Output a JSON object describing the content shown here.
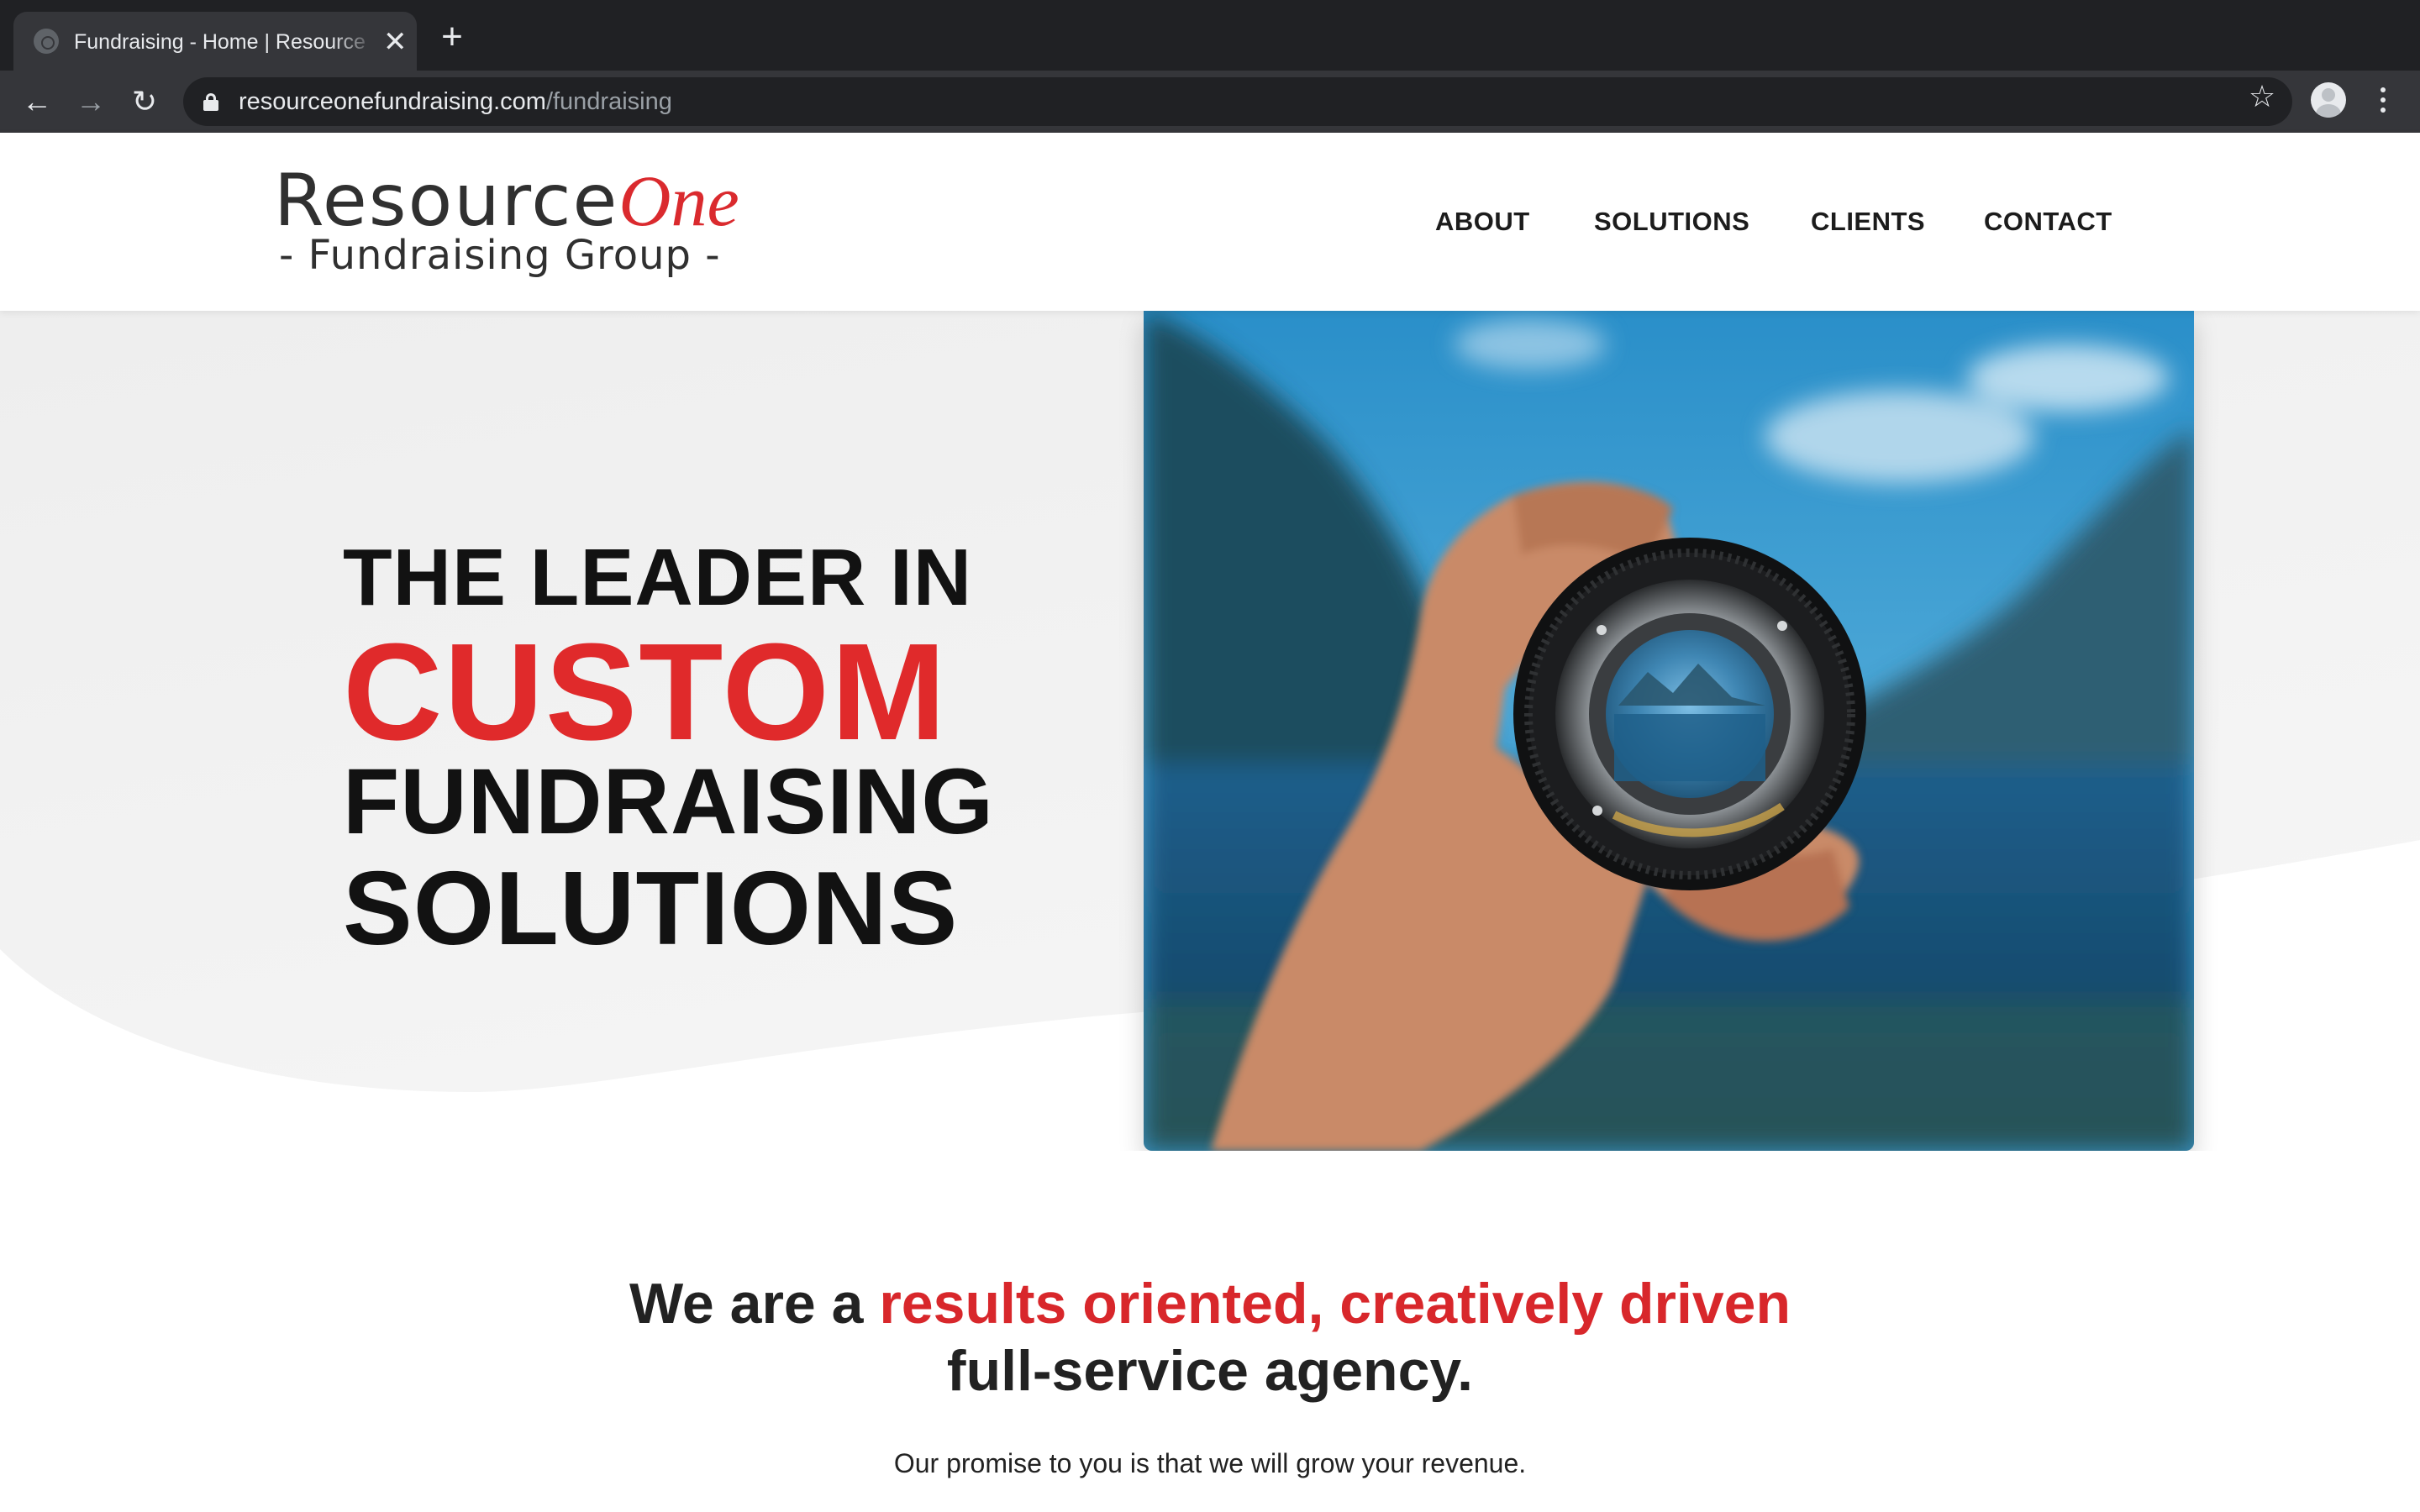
{
  "browser": {
    "tab_title": "Fundraising - Home | Resource",
    "tab_close": "✕",
    "new_tab": "+",
    "back": "←",
    "forward": "→",
    "reload": "↻",
    "url_host": "resourceonefundraising.com",
    "url_path": "/fundraising",
    "bookmark_star": "☆"
  },
  "site": {
    "logo": {
      "resource": "Resource",
      "one": "One",
      "subtitle": "- Fundraising Group -"
    },
    "nav": [
      "ABOUT",
      "SOLUTIONS",
      "CLIENTS",
      "CONTACT"
    ]
  },
  "hero": {
    "line1": "THE LEADER IN",
    "line2": "CUSTOM",
    "line3": "FUNDRAISING",
    "line4": "SOLUTIONS"
  },
  "tagline": {
    "prefix": "We are a ",
    "highlight": "results oriented, creatively driven",
    "suffix": "full-service agency."
  },
  "promise": "Our promise to you is that we will grow your revenue.",
  "colors": {
    "accent_red": "#da2a2e",
    "chrome_dark": "#202124",
    "chrome_toolbar": "#35363a"
  }
}
